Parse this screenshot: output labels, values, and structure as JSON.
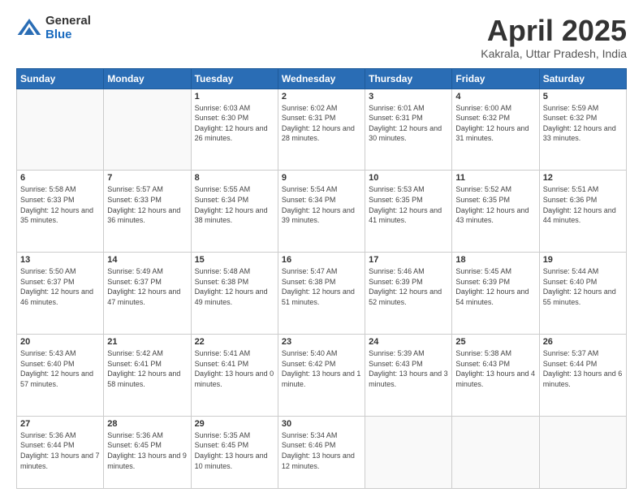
{
  "logo": {
    "general": "General",
    "blue": "Blue"
  },
  "title": "April 2025",
  "subtitle": "Kakrala, Uttar Pradesh, India",
  "days_header": [
    "Sunday",
    "Monday",
    "Tuesday",
    "Wednesday",
    "Thursday",
    "Friday",
    "Saturday"
  ],
  "weeks": [
    [
      {
        "day": "",
        "info": ""
      },
      {
        "day": "",
        "info": ""
      },
      {
        "day": "1",
        "info": "Sunrise: 6:03 AM\nSunset: 6:30 PM\nDaylight: 12 hours and 26 minutes."
      },
      {
        "day": "2",
        "info": "Sunrise: 6:02 AM\nSunset: 6:31 PM\nDaylight: 12 hours and 28 minutes."
      },
      {
        "day": "3",
        "info": "Sunrise: 6:01 AM\nSunset: 6:31 PM\nDaylight: 12 hours and 30 minutes."
      },
      {
        "day": "4",
        "info": "Sunrise: 6:00 AM\nSunset: 6:32 PM\nDaylight: 12 hours and 31 minutes."
      },
      {
        "day": "5",
        "info": "Sunrise: 5:59 AM\nSunset: 6:32 PM\nDaylight: 12 hours and 33 minutes."
      }
    ],
    [
      {
        "day": "6",
        "info": "Sunrise: 5:58 AM\nSunset: 6:33 PM\nDaylight: 12 hours and 35 minutes."
      },
      {
        "day": "7",
        "info": "Sunrise: 5:57 AM\nSunset: 6:33 PM\nDaylight: 12 hours and 36 minutes."
      },
      {
        "day": "8",
        "info": "Sunrise: 5:55 AM\nSunset: 6:34 PM\nDaylight: 12 hours and 38 minutes."
      },
      {
        "day": "9",
        "info": "Sunrise: 5:54 AM\nSunset: 6:34 PM\nDaylight: 12 hours and 39 minutes."
      },
      {
        "day": "10",
        "info": "Sunrise: 5:53 AM\nSunset: 6:35 PM\nDaylight: 12 hours and 41 minutes."
      },
      {
        "day": "11",
        "info": "Sunrise: 5:52 AM\nSunset: 6:35 PM\nDaylight: 12 hours and 43 minutes."
      },
      {
        "day": "12",
        "info": "Sunrise: 5:51 AM\nSunset: 6:36 PM\nDaylight: 12 hours and 44 minutes."
      }
    ],
    [
      {
        "day": "13",
        "info": "Sunrise: 5:50 AM\nSunset: 6:37 PM\nDaylight: 12 hours and 46 minutes."
      },
      {
        "day": "14",
        "info": "Sunrise: 5:49 AM\nSunset: 6:37 PM\nDaylight: 12 hours and 47 minutes."
      },
      {
        "day": "15",
        "info": "Sunrise: 5:48 AM\nSunset: 6:38 PM\nDaylight: 12 hours and 49 minutes."
      },
      {
        "day": "16",
        "info": "Sunrise: 5:47 AM\nSunset: 6:38 PM\nDaylight: 12 hours and 51 minutes."
      },
      {
        "day": "17",
        "info": "Sunrise: 5:46 AM\nSunset: 6:39 PM\nDaylight: 12 hours and 52 minutes."
      },
      {
        "day": "18",
        "info": "Sunrise: 5:45 AM\nSunset: 6:39 PM\nDaylight: 12 hours and 54 minutes."
      },
      {
        "day": "19",
        "info": "Sunrise: 5:44 AM\nSunset: 6:40 PM\nDaylight: 12 hours and 55 minutes."
      }
    ],
    [
      {
        "day": "20",
        "info": "Sunrise: 5:43 AM\nSunset: 6:40 PM\nDaylight: 12 hours and 57 minutes."
      },
      {
        "day": "21",
        "info": "Sunrise: 5:42 AM\nSunset: 6:41 PM\nDaylight: 12 hours and 58 minutes."
      },
      {
        "day": "22",
        "info": "Sunrise: 5:41 AM\nSunset: 6:41 PM\nDaylight: 13 hours and 0 minutes."
      },
      {
        "day": "23",
        "info": "Sunrise: 5:40 AM\nSunset: 6:42 PM\nDaylight: 13 hours and 1 minute."
      },
      {
        "day": "24",
        "info": "Sunrise: 5:39 AM\nSunset: 6:43 PM\nDaylight: 13 hours and 3 minutes."
      },
      {
        "day": "25",
        "info": "Sunrise: 5:38 AM\nSunset: 6:43 PM\nDaylight: 13 hours and 4 minutes."
      },
      {
        "day": "26",
        "info": "Sunrise: 5:37 AM\nSunset: 6:44 PM\nDaylight: 13 hours and 6 minutes."
      }
    ],
    [
      {
        "day": "27",
        "info": "Sunrise: 5:36 AM\nSunset: 6:44 PM\nDaylight: 13 hours and 7 minutes."
      },
      {
        "day": "28",
        "info": "Sunrise: 5:36 AM\nSunset: 6:45 PM\nDaylight: 13 hours and 9 minutes."
      },
      {
        "day": "29",
        "info": "Sunrise: 5:35 AM\nSunset: 6:45 PM\nDaylight: 13 hours and 10 minutes."
      },
      {
        "day": "30",
        "info": "Sunrise: 5:34 AM\nSunset: 6:46 PM\nDaylight: 13 hours and 12 minutes."
      },
      {
        "day": "",
        "info": ""
      },
      {
        "day": "",
        "info": ""
      },
      {
        "day": "",
        "info": ""
      }
    ]
  ]
}
